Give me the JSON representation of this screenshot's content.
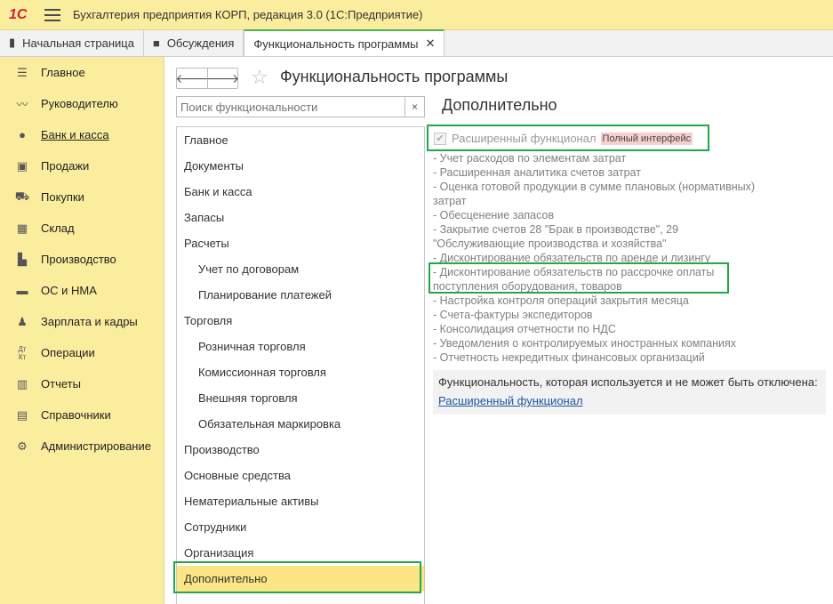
{
  "window": {
    "logo": "1С",
    "title": "Бухгалтерия предприятия КОРП, редакция 3.0  (1С:Предприятие)"
  },
  "tabs": [
    {
      "label": "Начальная страница",
      "icon": "home-icon"
    },
    {
      "label": "Обсуждения",
      "icon": "chat-icon"
    },
    {
      "label": "Функциональность программы",
      "active": true
    }
  ],
  "sidebar": {
    "items": [
      {
        "label": "Главное",
        "icon": "menu-lines-icon"
      },
      {
        "label": "Руководителю",
        "icon": "trend-icon"
      },
      {
        "label": "Банк и касса",
        "icon": "coin-icon"
      },
      {
        "label": "Продажи",
        "icon": "bag-icon"
      },
      {
        "label": "Покупки",
        "icon": "cart-icon"
      },
      {
        "label": "Склад",
        "icon": "warehouse-icon"
      },
      {
        "label": "Производство",
        "icon": "factory-icon"
      },
      {
        "label": "ОС и НМА",
        "icon": "truck-icon"
      },
      {
        "label": "Зарплата и кадры",
        "icon": "person-icon"
      },
      {
        "label": "Операции",
        "icon": "dt-kt-icon"
      },
      {
        "label": "Отчеты",
        "icon": "bar-chart-icon"
      },
      {
        "label": "Справочники",
        "icon": "book-icon"
      },
      {
        "label": "Администрирование",
        "icon": "gear-icon"
      }
    ]
  },
  "page": {
    "title": "Функциональность программы",
    "search_placeholder": "Поиск функциональности",
    "nav_back": "🡐",
    "nav_forward": "🡒",
    "star": "☆",
    "clear": "×"
  },
  "sections": [
    {
      "label": "Главное"
    },
    {
      "label": "Документы"
    },
    {
      "label": "Банк и касса"
    },
    {
      "label": "Запасы"
    },
    {
      "label": "Расчеты"
    },
    {
      "label": "Учет по договорам",
      "sub": true
    },
    {
      "label": "Планирование платежей",
      "sub": true
    },
    {
      "label": "Торговля"
    },
    {
      "label": "Розничная торговля",
      "sub": true
    },
    {
      "label": "Комиссионная торговля",
      "sub": true
    },
    {
      "label": "Внешняя торговля",
      "sub": true
    },
    {
      "label": "Обязательная маркировка",
      "sub": true
    },
    {
      "label": "Производство"
    },
    {
      "label": "Основные средства"
    },
    {
      "label": "Нематериальные активы"
    },
    {
      "label": "Сотрудники"
    },
    {
      "label": "Организация"
    },
    {
      "label": "Дополнительно",
      "selected": true
    }
  ],
  "detail": {
    "title": "Дополнительно",
    "checkbox_label": "Расширенный функционал",
    "checkbox_checked": true,
    "badge": "Полный интерфейс",
    "features": [
      "- Учет расходов по элементам затрат",
      "- Расширенная аналитика счетов затрат",
      "- Оценка готовой продукции в сумме плановых (нормативных)",
      "затрат",
      "- Обесценение запасов",
      "- Закрытие счетов 28 \"Брак в производстве\", 29",
      "\"Обслуживающие производства и хозяйства\"",
      "- Дисконтирование обязательств по аренде и лизингу",
      "- Дисконтирование обязательств по рассрочке оплаты",
      "поступления оборудования, товаров",
      "- Настройка контроля операций закрытия месяца",
      "- Счета-фактуры экспедиторов",
      "- Консолидация отчетности по НДС",
      "- Уведомления о контролируемых иностранных компаниях",
      "- Отчетность некредитных финансовых организаций"
    ],
    "info_text": "Функциональность, которая используется и не может быть отключена:",
    "info_link": "Расширенный функционал"
  },
  "colors": {
    "sidebar_bg": "#fbed9e",
    "selected_bg": "#fbe584",
    "highlight": "#21a84a",
    "link": "#1b57a0",
    "badge_bg": "#f7cfcf"
  }
}
